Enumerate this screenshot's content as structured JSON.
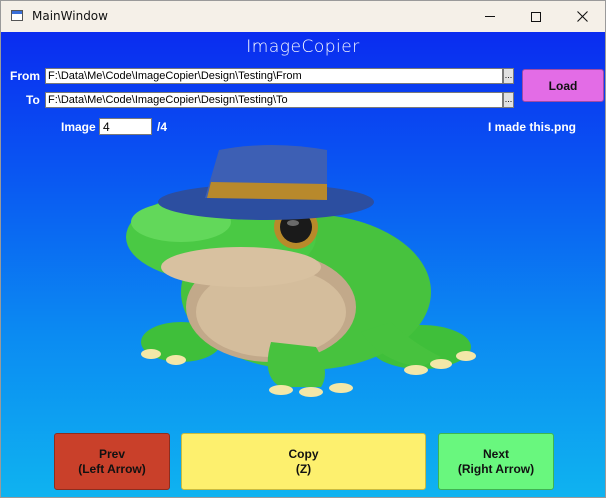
{
  "window": {
    "title": "MainWindow"
  },
  "app": {
    "heading": "ImageCopier"
  },
  "from": {
    "label": "From",
    "path": "F:\\Data\\Me\\Code\\ImageCopier\\Design\\Testing\\From",
    "browse": "..."
  },
  "to": {
    "label": "To",
    "path": "F:\\Data\\Me\\Code\\ImageCopier\\Design\\Testing\\To",
    "browse": "..."
  },
  "load_label": "Load",
  "image": {
    "label": "Image",
    "current": "4",
    "total": "/4",
    "filename": "I made this.png"
  },
  "buttons": {
    "prev": {
      "line1": "Prev",
      "line2": "(Left Arrow)",
      "color": "#c9402a"
    },
    "copy": {
      "line1": "Copy",
      "line2": "(Z)",
      "color": "#fdf06e"
    },
    "next": {
      "line1": "Next",
      "line2": "(Right Arrow)",
      "color": "#69f77e"
    }
  },
  "colors": {
    "background_top": "#0a2cf0",
    "background_bottom": "#0fb3f0",
    "load_button": "#e36ce6"
  },
  "icons": {
    "app": "window-app-icon",
    "minimize": "minimize-icon",
    "maximize": "maximize-icon",
    "close": "close-icon"
  }
}
